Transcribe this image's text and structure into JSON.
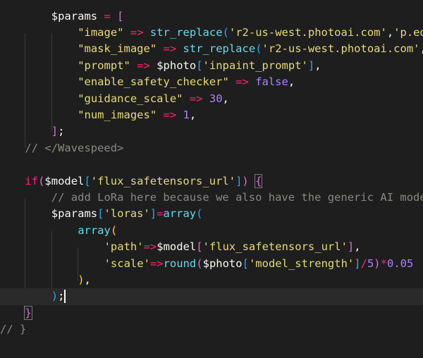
{
  "editor": {
    "current_line": 17,
    "lines": [
      {
        "indent": 8,
        "tokens": [
          [
            "$params",
            "v"
          ],
          [
            " ",
            "p"
          ],
          [
            "=",
            "op"
          ],
          [
            " ",
            "p"
          ],
          [
            "[",
            "b1"
          ]
        ]
      },
      {
        "indent": 12,
        "tokens": [
          [
            "\"image\"",
            "k"
          ],
          [
            " ",
            "p"
          ],
          [
            "=>",
            "op"
          ],
          [
            " ",
            "p"
          ],
          [
            "str_replace",
            "fn"
          ],
          [
            "(",
            "b2"
          ],
          [
            "'r2-us-west.photoai.com'",
            "s"
          ],
          [
            ",",
            "p"
          ],
          [
            "'p.ed",
            "s"
          ]
        ]
      },
      {
        "indent": 12,
        "tokens": [
          [
            "\"mask_image\"",
            "k"
          ],
          [
            " ",
            "p"
          ],
          [
            "=>",
            "op"
          ],
          [
            " ",
            "p"
          ],
          [
            "str_replace",
            "fn"
          ],
          [
            "(",
            "b2"
          ],
          [
            "'r2-us-west.photoai.com'",
            "s"
          ],
          [
            ",",
            "p"
          ]
        ]
      },
      {
        "indent": 12,
        "tokens": [
          [
            "\"prompt\"",
            "k"
          ],
          [
            " ",
            "p"
          ],
          [
            "=>",
            "op"
          ],
          [
            " ",
            "p"
          ],
          [
            "$photo",
            "v"
          ],
          [
            "[",
            "b2"
          ],
          [
            "'inpaint_prompt'",
            "s"
          ],
          [
            "]",
            "b2"
          ],
          [
            ",",
            "p"
          ]
        ]
      },
      {
        "indent": 12,
        "tokens": [
          [
            "\"enable_safety_checker\"",
            "k"
          ],
          [
            " ",
            "p"
          ],
          [
            "=>",
            "op"
          ],
          [
            " ",
            "p"
          ],
          [
            "false",
            "n"
          ],
          [
            ",",
            "p"
          ]
        ]
      },
      {
        "indent": 12,
        "tokens": [
          [
            "\"guidance_scale\"",
            "k"
          ],
          [
            " ",
            "p"
          ],
          [
            "=>",
            "op"
          ],
          [
            " ",
            "p"
          ],
          [
            "30",
            "n"
          ],
          [
            ",",
            "p"
          ]
        ]
      },
      {
        "indent": 12,
        "tokens": [
          [
            "\"num_images\"",
            "k"
          ],
          [
            " ",
            "p"
          ],
          [
            "=>",
            "op"
          ],
          [
            " ",
            "p"
          ],
          [
            "1",
            "n"
          ],
          [
            ",",
            "p"
          ]
        ]
      },
      {
        "indent": 8,
        "tokens": [
          [
            "]",
            "b1"
          ],
          [
            ";",
            "p"
          ]
        ]
      },
      {
        "indent": 4,
        "tokens": [
          [
            "// </Wavespeed>",
            "c"
          ]
        ]
      },
      {
        "indent": 0,
        "tokens": []
      },
      {
        "indent": 4,
        "tokens": [
          [
            "if",
            "kw"
          ],
          [
            "(",
            "b1"
          ],
          [
            "$model",
            "v"
          ],
          [
            "[",
            "b2"
          ],
          [
            "'flux_safetensors_url'",
            "s"
          ],
          [
            "]",
            "b2"
          ],
          [
            ")",
            "b1"
          ],
          [
            " ",
            "p"
          ],
          [
            "{",
            "b1 tok-box"
          ]
        ]
      },
      {
        "indent": 8,
        "tokens": [
          [
            "// add LoRa here because we also have the generic AI mode",
            "c"
          ]
        ]
      },
      {
        "indent": 8,
        "tokens": [
          [
            "$params",
            "v"
          ],
          [
            "[",
            "b2"
          ],
          [
            "'loras'",
            "s"
          ],
          [
            "]",
            "b2"
          ],
          [
            "=",
            "op"
          ],
          [
            "array",
            "fn"
          ],
          [
            "(",
            "b2"
          ]
        ]
      },
      {
        "indent": 12,
        "tokens": [
          [
            "array",
            "fn"
          ],
          [
            "(",
            "b3"
          ]
        ]
      },
      {
        "indent": 16,
        "tokens": [
          [
            "'path'",
            "s"
          ],
          [
            "=>",
            "op"
          ],
          [
            "$model",
            "v"
          ],
          [
            "[",
            "b1"
          ],
          [
            "'flux_safetensors_url'",
            "s"
          ],
          [
            "]",
            "b1"
          ],
          [
            ",",
            "p"
          ]
        ]
      },
      {
        "indent": 16,
        "tokens": [
          [
            "'scale'",
            "s"
          ],
          [
            "=>",
            "op"
          ],
          [
            "round",
            "fn"
          ],
          [
            "(",
            "b1"
          ],
          [
            "$photo",
            "v"
          ],
          [
            "[",
            "b2"
          ],
          [
            "'model_strength'",
            "s"
          ],
          [
            "]",
            "b2"
          ],
          [
            "/",
            "op"
          ],
          [
            "5",
            "n"
          ],
          [
            ")",
            "b1"
          ],
          [
            "*",
            "op"
          ],
          [
            "0.05",
            "n"
          ]
        ]
      },
      {
        "indent": 12,
        "tokens": [
          [
            ")",
            "b3"
          ],
          [
            ",",
            "p"
          ]
        ]
      },
      {
        "indent": 8,
        "tokens": [
          [
            ")",
            "b2"
          ],
          [
            ";",
            "p"
          ]
        ]
      },
      {
        "indent": 4,
        "tokens": [
          [
            "}",
            "b1 tok-box"
          ]
        ]
      },
      {
        "indent": 0,
        "tokens": [
          [
            "// }",
            "c"
          ]
        ]
      }
    ]
  }
}
